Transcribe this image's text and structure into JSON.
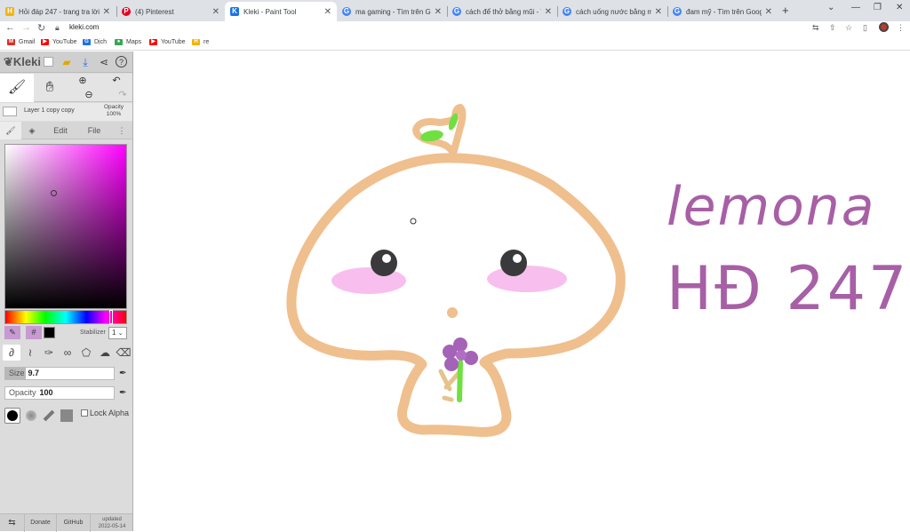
{
  "browser": {
    "tabs": [
      {
        "title": "Hỏi đáp 247 - trang tra lời",
        "fav_color": "#f4b400",
        "fav_glyph": "H"
      },
      {
        "title": "(4) Pinterest",
        "fav_color": "#e60023",
        "fav_glyph": "P"
      },
      {
        "title": "Kleki - Paint Tool",
        "fav_color": "#1a73e8",
        "fav_glyph": "K"
      },
      {
        "title": "ma gaming - Tìm trên Google",
        "fav_color": "#4285f4",
        "fav_glyph": "G"
      },
      {
        "title": "cách để thở bằng mũi - Tìm trê",
        "fav_color": "#4285f4",
        "fav_glyph": "G"
      },
      {
        "title": "cách uống nước bằng mồm -",
        "fav_color": "#4285f4",
        "fav_glyph": "G"
      },
      {
        "title": "đam mỹ - Tìm trên Google",
        "fav_color": "#4285f4",
        "fav_glyph": "G"
      }
    ],
    "active_tab_index": 2,
    "url": "kleki.com",
    "bookmarks": [
      {
        "label": "Gmail",
        "color": "#d93025",
        "glyph": "M"
      },
      {
        "label": "YouTube",
        "color": "#ff0000",
        "glyph": "▶"
      },
      {
        "label": "Dịch",
        "color": "#1a73e8",
        "glyph": "G"
      },
      {
        "label": "Maps",
        "color": "#34a853",
        "glyph": "●"
      },
      {
        "label": "YouTube",
        "color": "#ff0000",
        "glyph": "▶"
      },
      {
        "label": "re",
        "color": "#f4b400",
        "glyph": "H"
      }
    ]
  },
  "kleki": {
    "logo": "Kleki",
    "layer": {
      "name": "Layer 1 copy copy",
      "opacity_label": "Opacity",
      "opacity_value": "100%"
    },
    "tabs": {
      "edit": "Edit",
      "file": "File"
    },
    "stabilizer": {
      "label": "Stabilizer",
      "value": "1"
    },
    "color_hex_label": "#",
    "current_color": "#000000",
    "size": {
      "label": "Size",
      "value": "9.7",
      "fraction": 0.19
    },
    "opacity": {
      "label": "Opacity",
      "value": "100",
      "fraction": 0.0
    },
    "lock_alpha": "Lock Alpha",
    "footer": {
      "donate": "Donate",
      "github": "GitHub",
      "updated_label": "updated",
      "updated_date": "2022-05-14"
    }
  },
  "drawing": {
    "line1": "lemona",
    "line2": "HĐ 247",
    "stroke_color": "#efbf8e",
    "blush_color": "#f7b8ec",
    "sprout_color": "#70e040",
    "flower_color": "#a463b6",
    "text_color": "#a75fa6"
  }
}
